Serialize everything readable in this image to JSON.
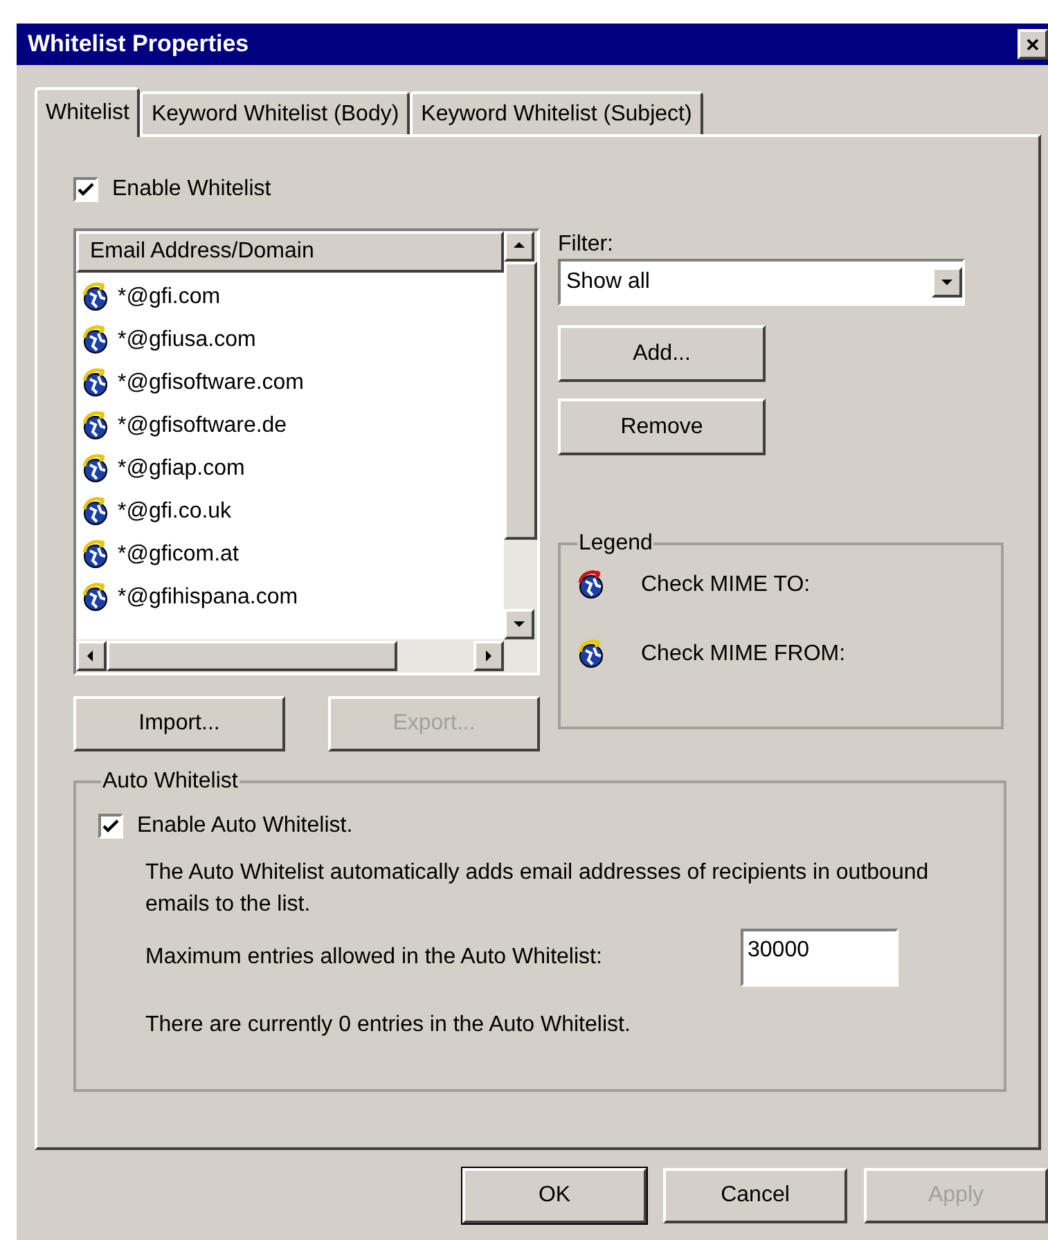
{
  "window": {
    "title": "Whitelist Properties",
    "close_label": "✕"
  },
  "tabs": [
    {
      "label": "Whitelist",
      "selected": true
    },
    {
      "label": "Keyword Whitelist (Body)",
      "selected": false
    },
    {
      "label": "Keyword Whitelist (Subject)",
      "selected": false
    }
  ],
  "enable_whitelist": {
    "label": "Enable Whitelist",
    "checked": true
  },
  "list": {
    "column": "Email Address/Domain",
    "items": [
      {
        "text": "*@gfi.com",
        "kind": "from"
      },
      {
        "text": "*@gfiusa.com",
        "kind": "from"
      },
      {
        "text": "*@gfisoftware.com",
        "kind": "from"
      },
      {
        "text": "*@gfisoftware.de",
        "kind": "from"
      },
      {
        "text": "*@gfiap.com",
        "kind": "from"
      },
      {
        "text": "*@gfi.co.uk",
        "kind": "from"
      },
      {
        "text": "*@gficom.at",
        "kind": "from"
      },
      {
        "text": "*@gfihispana.com",
        "kind": "from"
      }
    ]
  },
  "filter": {
    "label": "Filter:",
    "value": "Show all"
  },
  "side_buttons": [
    {
      "label": "Add...",
      "disabled": false
    },
    {
      "label": "Remove",
      "disabled": false
    }
  ],
  "list_buttons": [
    {
      "label": "Import...",
      "disabled": false
    },
    {
      "label": "Export...",
      "disabled": true
    }
  ],
  "legend": {
    "title": "Legend",
    "items": [
      {
        "kind": "to",
        "label": "Check MIME TO:"
      },
      {
        "kind": "from",
        "label": "Check MIME FROM:"
      }
    ]
  },
  "auto_whitelist": {
    "title": "Auto Whitelist",
    "enable": {
      "label": "Enable Auto Whitelist.",
      "checked": true
    },
    "description": "The Auto Whitelist automatically adds email addresses of recipients in outbound emails to the list.",
    "max_label": "Maximum entries allowed in the Auto Whitelist:",
    "max_value": "30000",
    "status": "There are currently 0 entries in the Auto Whitelist."
  },
  "buttons": [
    {
      "label": "OK",
      "disabled": false,
      "default": true
    },
    {
      "label": "Cancel",
      "disabled": false,
      "default": false
    },
    {
      "label": "Apply",
      "disabled": true,
      "default": false
    }
  ]
}
